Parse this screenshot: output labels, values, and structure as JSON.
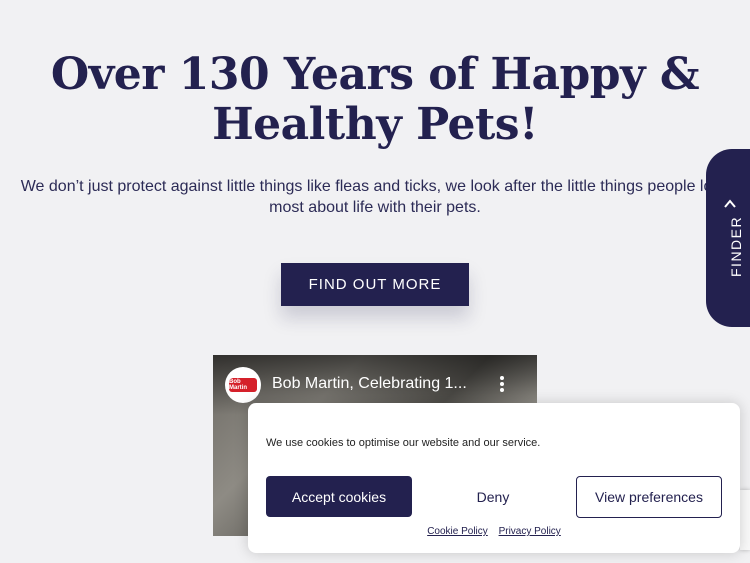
{
  "hero": {
    "title_line1": "Over 130 Years of Happy &",
    "title_line2": "Healthy Pets!",
    "subtitle": "We don’t just protect against little things like fleas and ticks, we look after the little things people love most about life with their pets.",
    "cta_label": "FIND OUT MORE"
  },
  "finder": {
    "label": "FINDER",
    "icon": "chevron-up-icon"
  },
  "video": {
    "channel_logo_text": "Bob Martin",
    "title": "Bob Martin, Celebrating 1...",
    "menu_icon": "more-vert-icon"
  },
  "cookie_banner": {
    "message": "We use cookies to optimise our website and our service.",
    "accept_label": "Accept cookies",
    "deny_label": "Deny",
    "preferences_label": "View preferences",
    "links": [
      "Cookie Policy",
      "Privacy Policy"
    ]
  },
  "colors": {
    "brand_navy": "#23214f",
    "background": "#f1f1f3",
    "white": "#ffffff"
  }
}
